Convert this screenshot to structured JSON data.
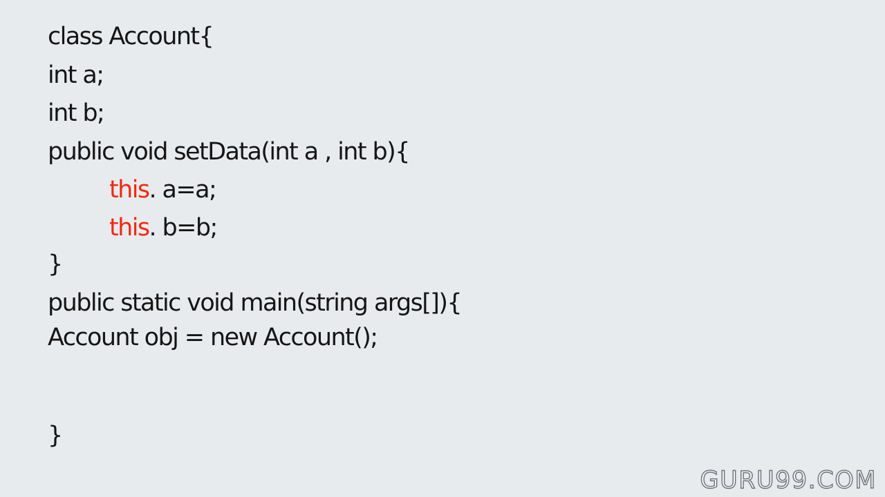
{
  "code": {
    "line1": "class Account{",
    "line2": "int a;",
    "line3": "int b;",
    "line4": "public void setData(int a , int b){",
    "line5": {
      "keyword": "this",
      "rest": ". a=a;"
    },
    "line6": {
      "keyword": "this",
      "rest": ". b=b;"
    },
    "line7": "}",
    "line8": "public static void main(string args[]){",
    "line9": "Account obj = new Account();",
    "line10": "}"
  },
  "watermark": "GURU99.COM",
  "colors": {
    "background": "#e8ebee",
    "text": "#151515",
    "keyword_this": "#ee2a12"
  }
}
